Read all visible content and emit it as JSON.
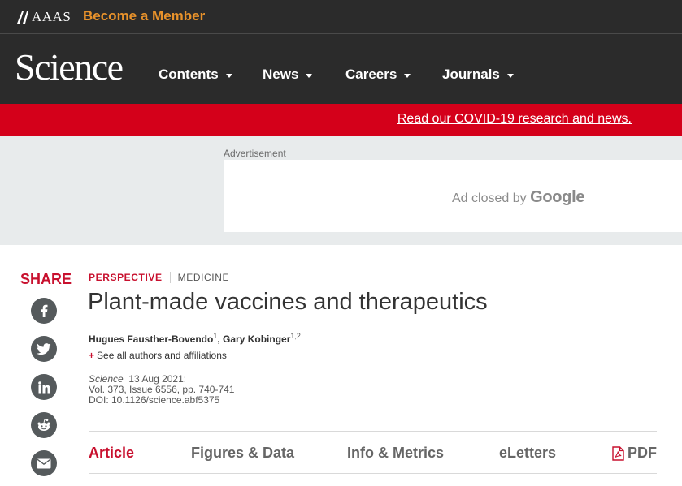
{
  "topbar": {
    "org": "AAAS",
    "member_link": "Become a Member"
  },
  "nav": {
    "wordmark": "Science",
    "items": [
      {
        "label": "Contents"
      },
      {
        "label": "News"
      },
      {
        "label": "Careers"
      },
      {
        "label": "Journals"
      }
    ]
  },
  "banner": {
    "link": "Read our COVID-19 research and news."
  },
  "ad": {
    "label": "Advertisement",
    "closed_text": "Ad closed by",
    "closed_brand": "Google"
  },
  "share": {
    "label": "SHARE",
    "icons": [
      "facebook-icon",
      "twitter-icon",
      "linkedin-icon",
      "reddit-icon",
      "email-icon"
    ]
  },
  "article": {
    "category": "PERSPECTIVE",
    "subject": "MEDICINE",
    "title": "Plant-made vaccines and therapeutics",
    "authors": [
      {
        "name": "Hugues Fausther-Bovendo",
        "aff": "1"
      },
      {
        "name": "Gary Kobinger",
        "aff": "1,2"
      }
    ],
    "author_separator": ", ",
    "see_all": "See all authors and affiliations",
    "see_all_prefix": "+",
    "journal": "Science",
    "date": "13 Aug 2021:",
    "volume": "Vol. 373, Issue 6556, pp. 740-741",
    "doi": "DOI: 10.1126/science.abf5375"
  },
  "tabs": [
    {
      "label": "Article",
      "active": true
    },
    {
      "label": "Figures & Data",
      "active": false
    },
    {
      "label": "Info & Metrics",
      "active": false
    },
    {
      "label": "eLetters",
      "active": false
    },
    {
      "label": "PDF",
      "active": false
    }
  ],
  "colors": {
    "dark_bg": "#2b2b2b",
    "accent_red": "#c8102e",
    "banner_red": "#d4001a",
    "member_orange": "#e8922b"
  }
}
